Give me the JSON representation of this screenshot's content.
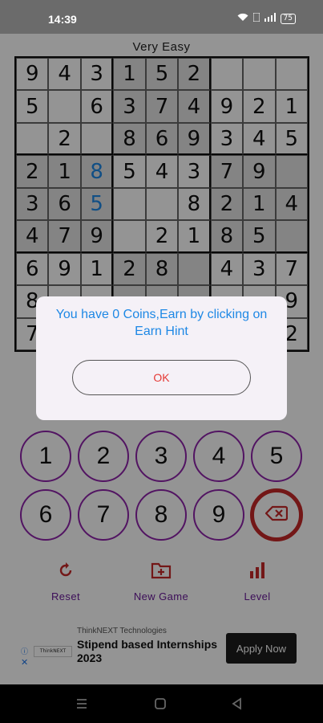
{
  "status_bar": {
    "time": "14:39",
    "battery": "75"
  },
  "level_title": "Very Easy",
  "board": [
    [
      "9",
      "4",
      "3",
      "1",
      "5",
      "2",
      "",
      "",
      ""
    ],
    [
      "5",
      "",
      "6",
      "3",
      "7",
      "4",
      "9",
      "2",
      "1"
    ],
    [
      "",
      "2",
      "",
      "8",
      "6",
      "9",
      "3",
      "4",
      "5"
    ],
    [
      "2",
      "1",
      "8",
      "5",
      "4",
      "3",
      "7",
      "9",
      ""
    ],
    [
      "3",
      "6",
      "5",
      "",
      "",
      "8",
      "2",
      "1",
      "4"
    ],
    [
      "4",
      "7",
      "9",
      "",
      "2",
      "1",
      "8",
      "5",
      ""
    ],
    [
      "6",
      "9",
      "1",
      "2",
      "8",
      "",
      "4",
      "3",
      "7"
    ],
    [
      "8",
      "",
      "",
      "",
      "",
      "",
      "",
      "",
      "9"
    ],
    [
      "7",
      "",
      "",
      "",
      "",
      "",
      "",
      "",
      "2"
    ]
  ],
  "user_entries": [
    [
      3,
      2
    ],
    [
      4,
      2
    ]
  ],
  "numpad": [
    "1",
    "2",
    "3",
    "4",
    "5",
    "6",
    "7",
    "8",
    "9"
  ],
  "actions": {
    "reset": "Reset",
    "new_game": "New Game",
    "level": "Level"
  },
  "ad": {
    "company": "ThinkNEXT Technologies",
    "headline": "Stipend based Internships 2023",
    "cta": "Apply Now",
    "logo_text": "ThinkNEXT"
  },
  "dialog": {
    "message": "You have 0 Coins,Earn by clicking on Earn Hint",
    "ok_label": "OK"
  },
  "colors": {
    "accent_purple": "#8e24aa",
    "erase_red": "#c62828",
    "user_blue": "#1e88e5",
    "ok_red": "#e53935"
  }
}
